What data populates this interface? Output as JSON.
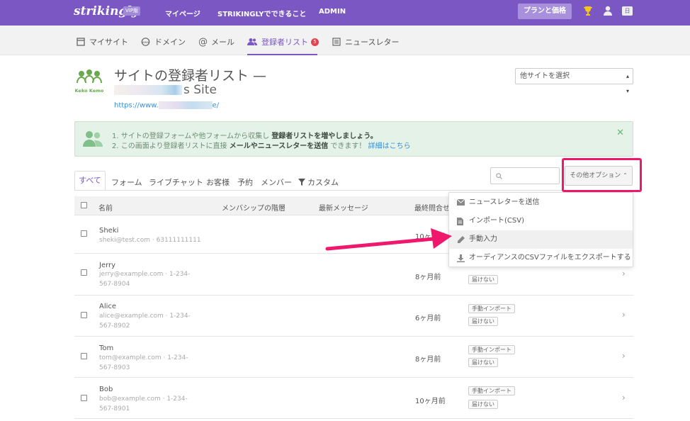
{
  "topbar": {
    "brand": "strikingly",
    "vip_badge": "VIP版",
    "nav": [
      "マイページ",
      "STRIKINGLYでできること",
      "ADMIN"
    ],
    "plan_button": "プランと価格",
    "lang_badge": "日"
  },
  "subnav": {
    "items": [
      {
        "label": "マイサイト",
        "icon": "monitor-icon"
      },
      {
        "label": "ドメイン",
        "icon": "www-icon"
      },
      {
        "label": "メール",
        "icon": "at-icon"
      },
      {
        "label": "登録者リスト",
        "icon": "people-icon",
        "badge": "5",
        "active": true
      },
      {
        "label": "ニュースレター",
        "icon": "newsletter-icon"
      }
    ]
  },
  "header": {
    "logo_text": "Keko Kemo",
    "title": "サイトの登録者リスト —",
    "site_name_suffix": "s Site",
    "url_prefix": "https://www.",
    "url_suffix": "e/",
    "site_select": "他サイトを選択"
  },
  "banner": {
    "line1_a": "1. サイトの登録フォームや他フォームから収集し",
    "line1_b": "登録者リストを増やしましょう。",
    "line2_a": "2. この画面より登録者リストに直接",
    "line2_b": "メールやニュースレターを送信",
    "line2_c": "できます！",
    "line2_link": "詳細はこちら"
  },
  "filters": {
    "tabs": [
      "すべて",
      "フォーム",
      "ライブチャット",
      "お客様",
      "予約",
      "メンバー",
      "カスタム"
    ],
    "options_button": "その他オプション"
  },
  "table": {
    "columns": [
      "名前",
      "メンバシップの階層",
      "最新メッセージ",
      "最終問合せ日"
    ],
    "rows": [
      {
        "name": "Sheki",
        "meta": "sheki@test.com · 63111111111",
        "date": "10ヶ月前",
        "tags": []
      },
      {
        "name": "Jerry",
        "meta": "jerry@example.com · 1-234-567-8904",
        "date": "8ヶ月前",
        "tags": [
          "届けない"
        ]
      },
      {
        "name": "Alice",
        "meta": "alice@example.com · 1-234-567-8902",
        "date": "6ヶ月前",
        "tags": [
          "手動インポート",
          "届けない"
        ]
      },
      {
        "name": "Tom",
        "meta": "tom@example.com · 1-234-567-8903",
        "date": "8ヶ月前",
        "tags": [
          "手動インポート",
          "届けない"
        ]
      },
      {
        "name": "Bob",
        "meta": "bob@example.com · 1-234-567-8901",
        "date": "10ヶ月前",
        "tags": [
          "手動インポート",
          "届けない"
        ]
      }
    ]
  },
  "menu": {
    "items": [
      {
        "label": "ニュースレターを送信",
        "icon": "envelope-icon"
      },
      {
        "label": "インポート(CSV)",
        "icon": "file-icon"
      },
      {
        "label": "手動入力",
        "icon": "pencil-icon",
        "highlighted": true
      },
      {
        "label": "オーディアンスのCSVファイルをエクスポートする",
        "icon": "download-icon"
      }
    ]
  },
  "colors": {
    "brand_purple": "#7b57c4",
    "annotation_pink": "#f0186c",
    "banner_green": "#e4f2e7",
    "link_blue": "#3b8fd6"
  }
}
